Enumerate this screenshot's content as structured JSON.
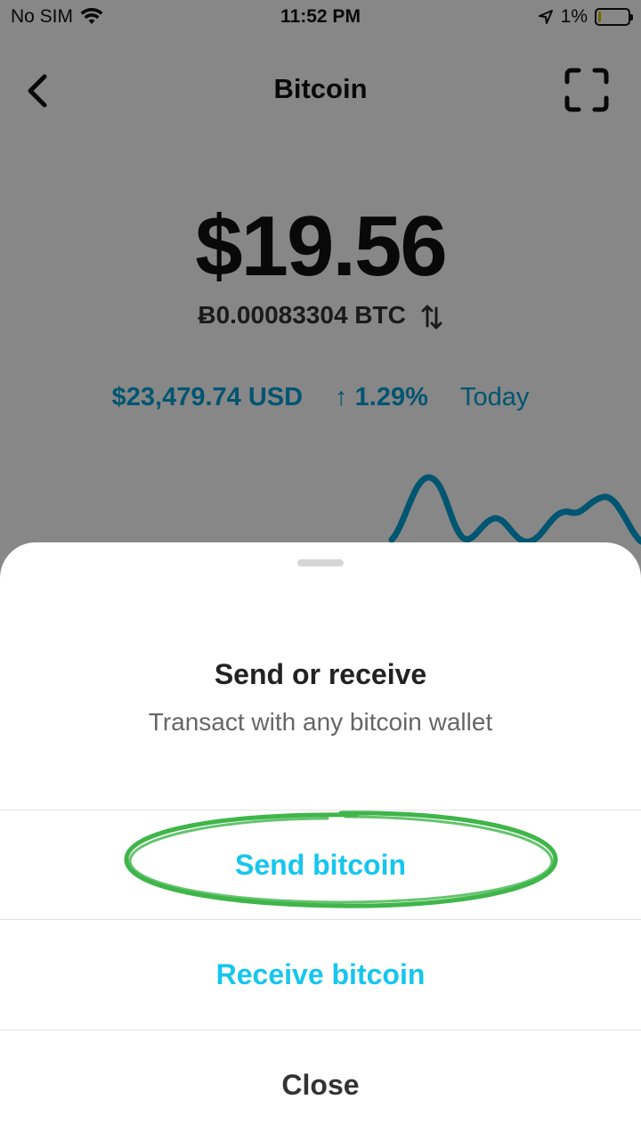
{
  "status_bar": {
    "carrier": "No SIM",
    "time": "11:52 PM",
    "battery_percent": "1%"
  },
  "nav": {
    "title": "Bitcoin",
    "back_icon": "chevron-left-icon",
    "scan_icon": "scan-frame-icon"
  },
  "balance": {
    "usd": "$19.56",
    "btc": "Ƀ0.00083304 BTC",
    "swap_icon": "swap-arrows-icon"
  },
  "price": {
    "value": "$23,479.74 USD",
    "change": "↑ 1.29%",
    "period": "Today"
  },
  "colors": {
    "accent": "#00a0d6",
    "action_blue": "#16c6ee",
    "annotation_green": "#3fb54a"
  },
  "sheet": {
    "title": "Send or receive",
    "subtitle": "Transact with any bitcoin wallet",
    "actions": {
      "send": "Send bitcoin",
      "receive": "Receive bitcoin",
      "close": "Close"
    }
  }
}
